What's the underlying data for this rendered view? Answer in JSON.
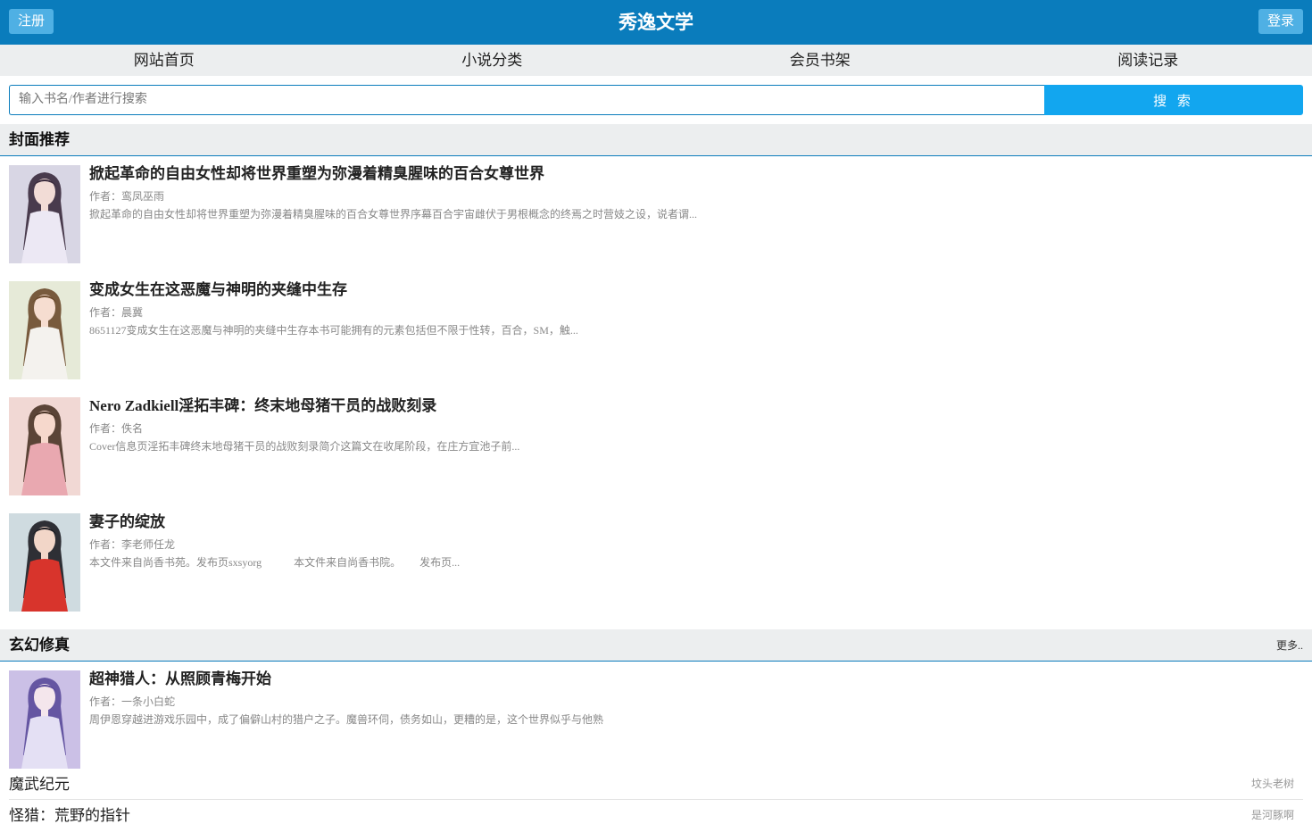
{
  "header": {
    "register_label": "注册",
    "title": "秀逸文学",
    "login_label": "登录"
  },
  "nav": {
    "items": [
      "网站首页",
      "小说分类",
      "会员书架",
      "阅读记录"
    ]
  },
  "search": {
    "placeholder": "输入书名/作者进行搜索",
    "button_label": "搜 索"
  },
  "featured": {
    "title": "封面推荐",
    "books": [
      {
        "title": "掀起革命的自由女性却将世界重塑为弥漫着精臭腥味的百合女尊世界",
        "author": "作者：鸾凤巫雨",
        "intro": "掀起革命的自由女性却将世界重塑为弥漫着精臭腥味的百合女尊世界序幕百合宇宙雌伏于男根概念的终焉之时营妓之设，说者谓..."
      },
      {
        "title": "变成女生在这恶魔与神明的夹缝中生存",
        "author": "作者：晨冀",
        "intro": "8651127变成女生在这恶魔与神明的夹缝中生存本书可能拥有的元素包括但不限于性转，百合，SM，触..."
      },
      {
        "title": "Nero Zadkiell淫拓丰碑：终末地母猪干员的战败刻录",
        "author": "作者：佚名",
        "intro": "Cover信息页淫拓丰碑终末地母猪干员的战败刻录简介这篇文在收尾阶段，在庄方宜池子前..."
      },
      {
        "title": "妻子的绽放",
        "author": "作者：李老师任龙",
        "intro": "本文件来自尚香书苑。发布页sxsyorg            本文件来自尚香书院。       发布页..."
      }
    ]
  },
  "xuanhuan": {
    "title": "玄幻修真",
    "more_label": "更多..",
    "top_book": {
      "title": "超神猎人：从照顾青梅开始",
      "author": "作者：一条小白蛇",
      "intro": "周伊恩穿越进游戏乐园中，成了偏僻山村的猎户之子。魔兽环伺，债务如山，更糟的是，这个世界似乎与他熟"
    },
    "list": [
      {
        "name": "魔武纪元",
        "author": "坟头老树"
      },
      {
        "name": "怪猎：荒野的指针",
        "author": "是河豚啊"
      }
    ]
  },
  "cover_palettes": [
    {
      "bg": "#d8d6e4",
      "hair": "#3a2a3c",
      "skin": "#f2dcd6",
      "dress": "#ece8f4"
    },
    {
      "bg": "#e6ead8",
      "hair": "#6b4a2c",
      "skin": "#f6ddd0",
      "dress": "#f4f2ee"
    },
    {
      "bg": "#f1d8d4",
      "hair": "#4a3426",
      "skin": "#f6d8cc",
      "dress": "#e9a8b0"
    },
    {
      "bg": "#cfdbe0",
      "hair": "#1c1c22",
      "skin": "#f2d6c8",
      "dress": "#d8342c"
    },
    {
      "bg": "#cbc0e6",
      "hair": "#5a4a9a",
      "skin": "#f4e6ec",
      "dress": "#e4e0f4"
    }
  ]
}
